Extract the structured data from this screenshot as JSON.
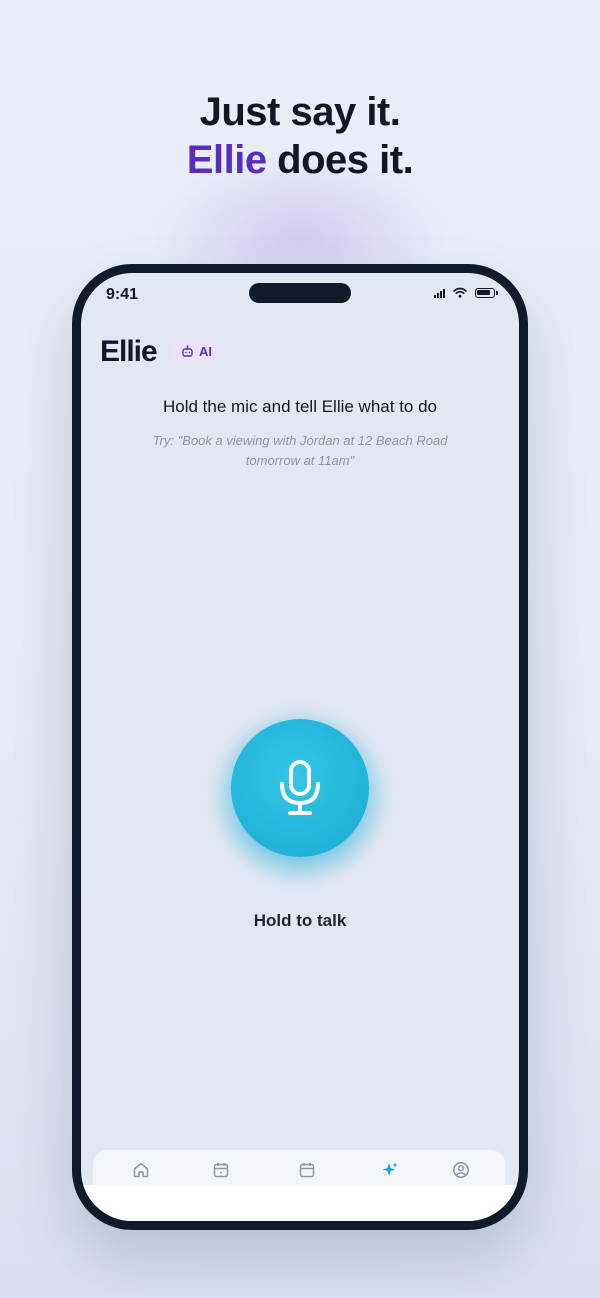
{
  "headline": {
    "line1": "Just say it.",
    "accent": "Ellie",
    "line2_rest": " does it."
  },
  "status_bar": {
    "time": "9:41",
    "icons": [
      "signal-icon",
      "wifi-icon",
      "battery-icon"
    ]
  },
  "header": {
    "app_name": "Ellie",
    "badge_label": "AI",
    "badge_icon": "robot-icon"
  },
  "main": {
    "instruction": "Hold the mic and tell Ellie what to do",
    "hint": "Try: \"Book a viewing with Jordan at 12 Beach Road tomorrow at 11am\"",
    "mic_icon": "microphone-icon",
    "hold_label": "Hold to talk"
  },
  "tabbar": {
    "tabs": [
      {
        "icon": "home-icon",
        "active": false
      },
      {
        "icon": "calendar-icon",
        "active": false
      },
      {
        "icon": "calendar-icon",
        "active": false
      },
      {
        "icon": "sparkles-icon",
        "active": true
      },
      {
        "icon": "profile-icon",
        "active": false
      }
    ]
  },
  "colors": {
    "accent_purple": "#5b2db8",
    "mic_blue": "#1fb3da",
    "active_tab": "#1ba6cf",
    "inactive_tab": "#8a95a8"
  }
}
